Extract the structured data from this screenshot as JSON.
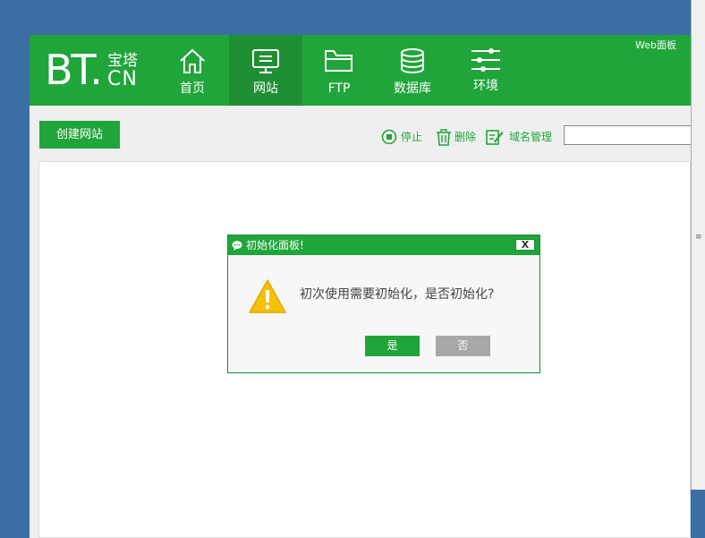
{
  "logo": {
    "text_bt": "BT.",
    "text_cn_top": "宝塔",
    "text_cn_bot": "CN"
  },
  "header": {
    "web_label": "Web面板"
  },
  "nav": [
    {
      "label": "首页",
      "icon": "home-icon"
    },
    {
      "label": "网站",
      "icon": "monitor-icon",
      "active": true
    },
    {
      "label": "FTP",
      "icon": "folder-icon"
    },
    {
      "label": "数据库",
      "icon": "database-icon"
    },
    {
      "label": "环境",
      "icon": "sliders-icon"
    }
  ],
  "toolbar": {
    "create_label": "创建网站",
    "stop_label": "停止",
    "delete_label": "删除",
    "domain_label": "域名管理",
    "search_value": ""
  },
  "dialog": {
    "title": "初始化面板!",
    "close_label": "X",
    "message": "初次使用需要初始化，是否初始化?",
    "yes_label": "是",
    "no_label": "否"
  },
  "colors": {
    "brand": "#20a53a",
    "brand_dark": "#1e8f33",
    "desktop": "#3a6ea5",
    "warning": "#f5c100"
  }
}
